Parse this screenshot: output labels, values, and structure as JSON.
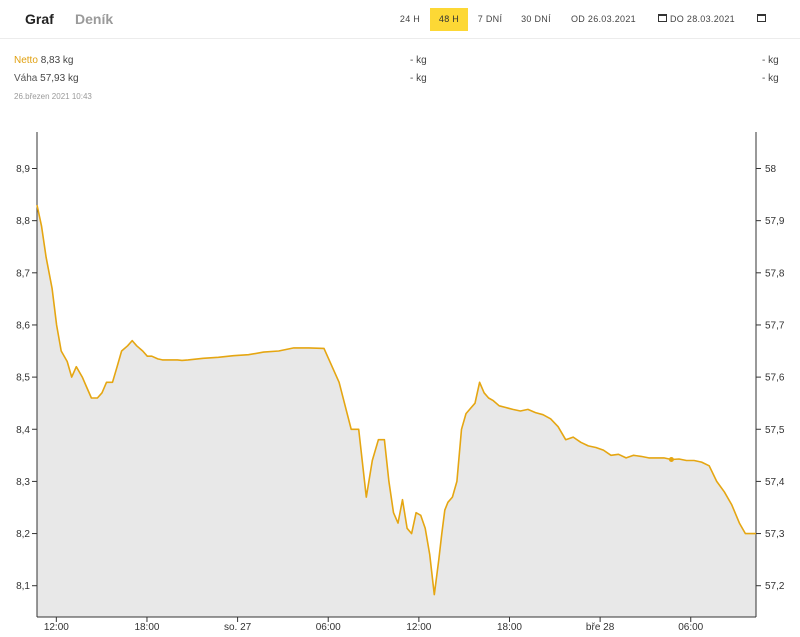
{
  "tabs": {
    "graf": "Graf",
    "denik": "Deník"
  },
  "ranges": [
    "24 H",
    "48 H",
    "7 DNÍ",
    "30 DNÍ"
  ],
  "active_range": "48 H",
  "date_from": "OD 26.03.2021",
  "date_to": "DO 28.03.2021",
  "icons": [
    "calendar-icon"
  ],
  "accent_color": "#fdd835",
  "series_color": "#e5a612",
  "legend": {
    "netto_label": "Netto",
    "netto_value": "8,83 kg",
    "vaha_label": "Váha",
    "vaha_value": "57,93 kg",
    "mid_netto": "- kg",
    "mid_vaha": "- kg",
    "right_netto": "- kg",
    "right_vaha": "- kg",
    "timestamp": "26.březen 2021 10:43"
  },
  "chart_data": {
    "type": "area",
    "left_axis": {
      "ticks": [
        "8,9",
        "8,8",
        "8,7",
        "8,6",
        "8,5",
        "8,4",
        "8,3",
        "8,2",
        "8,1"
      ],
      "ylim": [
        8.04,
        8.97
      ]
    },
    "right_axis": {
      "ticks": [
        "58",
        "57,9",
        "57,8",
        "57,7",
        "57,6",
        "57,5",
        "57,4",
        "57,3",
        "57,2"
      ]
    },
    "x_ticks": [
      "12:00",
      "18:00",
      "so. 27",
      "06:00",
      "12:00",
      "18:00",
      "bře 28",
      "06:00"
    ],
    "x_tick_hours": [
      1.28,
      7.28,
      13.28,
      19.28,
      25.28,
      31.28,
      37.28,
      43.28
    ],
    "xlim_hours": [
      0,
      47.6
    ],
    "grid": false,
    "series": [
      {
        "name": "Netto",
        "x": [
          0,
          0.3,
          0.6,
          1.0,
          1.3,
          1.6,
          2.0,
          2.3,
          2.6,
          3.0,
          3.3,
          3.6,
          4.0,
          4.3,
          4.6,
          5.0,
          5.3,
          5.6,
          6.0,
          6.3,
          6.6,
          7.0,
          7.3,
          7.6,
          8.0,
          8.3,
          8.6,
          9.0,
          9.3,
          9.6,
          10.0,
          11.0,
          12.0,
          13.0,
          14.0,
          15.0,
          16.0,
          17.0,
          18.0,
          19.0,
          20.0,
          20.8,
          21.3,
          21.8,
          22.2,
          22.6,
          23.0,
          23.3,
          23.6,
          23.9,
          24.2,
          24.5,
          24.8,
          25.1,
          25.4,
          25.7,
          26.0,
          26.3,
          26.6,
          26.8,
          27.0,
          27.2,
          27.5,
          27.8,
          28.1,
          28.4,
          28.7,
          29.0,
          29.3,
          29.6,
          29.9,
          30.2,
          30.6,
          31.0,
          31.5,
          32.0,
          32.5,
          33.0,
          33.5,
          34.0,
          34.5,
          35.0,
          35.5,
          36.0,
          36.5,
          37.0,
          37.5,
          38.0,
          38.5,
          39.0,
          39.5,
          40.0,
          40.5,
          41.0,
          41.5,
          42.0,
          42.5,
          43.0,
          43.5,
          44.0,
          44.5,
          45.0,
          45.5,
          46.0,
          46.5,
          46.9,
          47.2,
          47.6
        ],
        "y": [
          8.83,
          8.79,
          8.73,
          8.67,
          8.6,
          8.55,
          8.53,
          8.5,
          8.52,
          8.5,
          8.48,
          8.46,
          8.46,
          8.47,
          8.49,
          8.49,
          8.52,
          8.55,
          8.56,
          8.57,
          8.56,
          8.55,
          8.54,
          8.54,
          8.535,
          8.533,
          8.533,
          8.533,
          8.533,
          8.532,
          8.533,
          8.536,
          8.538,
          8.541,
          8.543,
          8.548,
          8.55,
          8.556,
          8.556,
          8.555,
          8.49,
          8.4,
          8.4,
          8.27,
          8.34,
          8.38,
          8.38,
          8.3,
          8.24,
          8.22,
          8.265,
          8.21,
          8.2,
          8.24,
          8.235,
          8.21,
          8.16,
          8.083,
          8.15,
          8.2,
          8.245,
          8.26,
          8.27,
          8.3,
          8.4,
          8.43,
          8.44,
          8.45,
          8.49,
          8.47,
          8.46,
          8.455,
          8.445,
          8.442,
          8.438,
          8.435,
          8.438,
          8.432,
          8.428,
          8.42,
          8.405,
          8.38,
          8.385,
          8.375,
          8.368,
          8.365,
          8.36,
          8.35,
          8.352,
          8.345,
          8.35,
          8.348,
          8.345,
          8.345,
          8.345,
          8.342,
          8.343,
          8.34,
          8.34,
          8.337,
          8.33,
          8.3,
          8.28,
          8.255,
          8.22,
          8.2,
          8.2,
          8.2
        ]
      }
    ]
  }
}
